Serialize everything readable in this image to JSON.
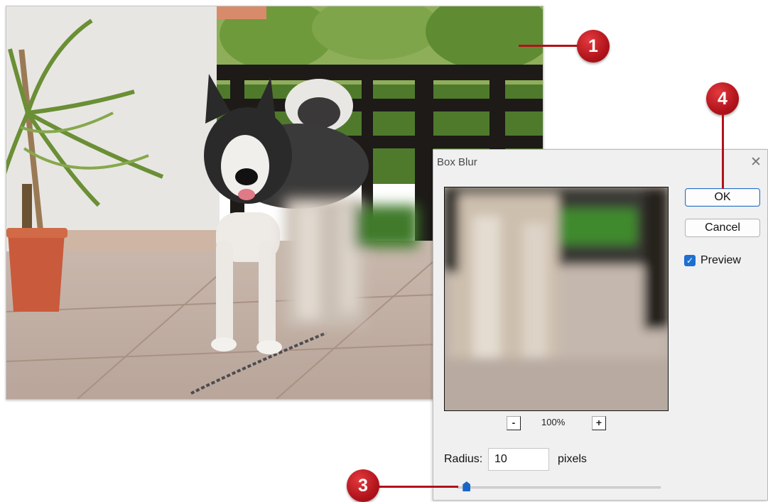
{
  "dialog": {
    "title": "Box Blur",
    "ok_label": "OK",
    "cancel_label": "Cancel",
    "preview_label": "Preview",
    "preview_checked": true,
    "zoom_out_label": "-",
    "zoom_in_label": "+",
    "zoom_level": "100%",
    "radius_label": "Radius:",
    "radius_value": "10",
    "units_label": "pixels",
    "radius_slider_fraction": 0.03
  },
  "callouts": {
    "one": "1",
    "three": "3",
    "four": "4"
  },
  "colors": {
    "callout_red": "#b3121b",
    "accent_blue": "#1e6fd0"
  }
}
